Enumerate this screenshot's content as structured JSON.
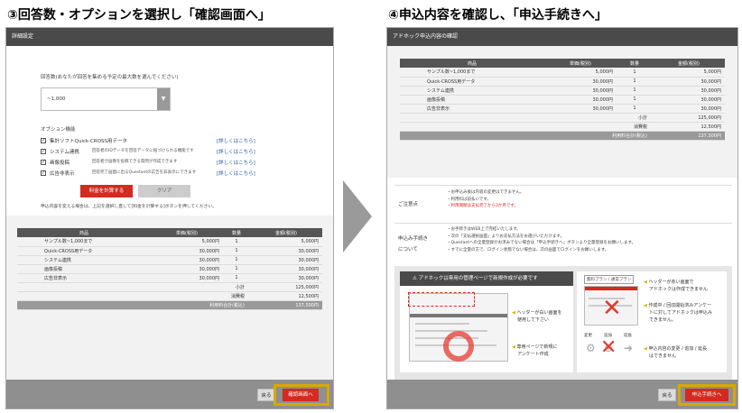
{
  "step3": {
    "title": "③回答数・オプションを選択し「確認画面へ」",
    "panel_title": "詳細設定",
    "answers_label": "回答数(あなたが回答を集める予定の最大数を選んでください)",
    "answers_value": "~1,000",
    "options_label": "オプション機能",
    "options": [
      {
        "name": "集計ソフトQuick-CROSS用データ",
        "desc": "",
        "link": "[詳しくはこちら]"
      },
      {
        "name": "システム連携",
        "desc": "回答者のIDデータを回答データに紐づけられる機能です",
        "link": "[詳しくはこちら]"
      },
      {
        "name": "画像投稿",
        "desc": "回答者が画像を投稿できる質問が作成できます",
        "link": "[詳しくはこちら]"
      },
      {
        "name": "広告非表示",
        "desc": "回答完了画面に出るQuestantの広告を非表示にできます",
        "link": "[詳しくはこちら]"
      }
    ],
    "calc_button": "料金を計算する",
    "clear_button": "クリア",
    "change_note": "申込内容を変える場合は、上記を選択し直して[料金を計算する]ボタンを押してください。",
    "back_button": "戻る",
    "next_button": "確認画面へ"
  },
  "step4": {
    "title": "④申込内容を確認し、「申込手続きへ」",
    "panel_title": "アドホック申込内容の確認",
    "notice_label": "ご注意点",
    "notices": [
      "・お申込み後は内容の変更はできません。",
      "・利用料は前払いです。",
      "・利用期間は支払完了から3か月です。"
    ],
    "procedure_label_1": "申込み手続き",
    "procedure_label_2": "について",
    "procedure_lines": [
      "・お手続きはWEB上で完結いたします。",
      "・次の「支払選択画面」よりお支払方法をお選びいただけます。",
      "・Questantへの全量登録がお済みでない場合は「申込手続きへ」ボタンより全量登録をお願いします。",
      "・すでに全量の方で、ログイン状態でない場合は、次の画面でログインをお願いします。"
    ],
    "banner_title": "アドホックは専用の管理ページで新規作成が必要です",
    "bullet_1_a": "ヘッダーが白い画面を",
    "bullet_1_b": "使用して下さい",
    "bullet_2_a": "専用ページで新規に",
    "bullet_2_b": "アンケート作成",
    "plan_label": "無料プラン / 通常プラン",
    "right_note_1_a": "ヘッダーが赤い画面で",
    "right_note_1_b": "アドホックは作成できません",
    "right_note_2_a": "作成中 / 回収開始済みアンケー",
    "right_note_2_b": "トに対してアドホックは申込み",
    "right_note_2_c": "できません。",
    "change_word": "変更",
    "add_word": "追加",
    "extend_word": "延長",
    "right_note_3_a": "申込内容の変更 / 追加 / 延長",
    "right_note_3_b": "はできません",
    "back_button": "戻る",
    "next_button": "申込手続きへ"
  },
  "price_table": {
    "headers": [
      "商品",
      "単価(税別)",
      "数量",
      "金額(税別)"
    ],
    "rows": [
      {
        "name": "サンプル数~1,000まで",
        "unit": "5,000円",
        "qty": "1",
        "amount": "5,000円"
      },
      {
        "name": "Quick-CROSS用データ",
        "unit": "30,000円",
        "qty": "1",
        "amount": "30,000円"
      },
      {
        "name": "システム連携",
        "unit": "30,000円",
        "qty": "1",
        "amount": "30,000円"
      },
      {
        "name": "画像投稿",
        "unit": "30,000円",
        "qty": "1",
        "amount": "30,000円"
      },
      {
        "name": "広告非表示",
        "unit": "30,000円",
        "qty": "1",
        "amount": "30,000円"
      }
    ],
    "subtotal_label": "小計",
    "subtotal": "125,000円",
    "tax_label": "消費税",
    "tax": "12,500円",
    "total_label": "利用料合計(税込)",
    "total": "137,500円"
  }
}
